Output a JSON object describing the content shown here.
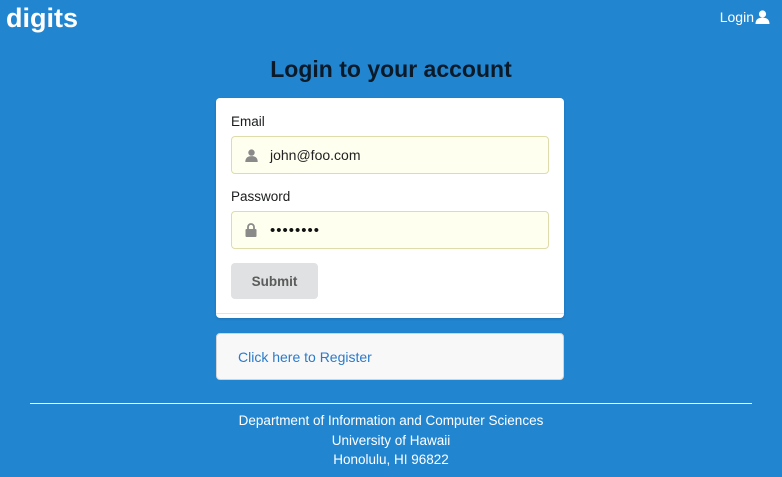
{
  "navbar": {
    "brand": "digits",
    "login_label": "Login",
    "login_icon": "user-icon"
  },
  "page": {
    "title": "Login to your account"
  },
  "form": {
    "email": {
      "label": "Email",
      "value": "john@foo.com",
      "icon": "user-icon"
    },
    "password": {
      "label": "Password",
      "value": "••••••••",
      "icon": "lock-icon"
    },
    "submit_label": "Submit"
  },
  "register": {
    "link_text": "Click here to Register"
  },
  "footer": {
    "line1": "Department of Information and Computer Sciences",
    "line2": "University of Hawaii",
    "line3": "Honolulu, HI 96822"
  },
  "colors": {
    "background": "#2185d0",
    "field_background": "#fffff0",
    "link": "#2b7ac9",
    "button": "#e0e1e2"
  }
}
